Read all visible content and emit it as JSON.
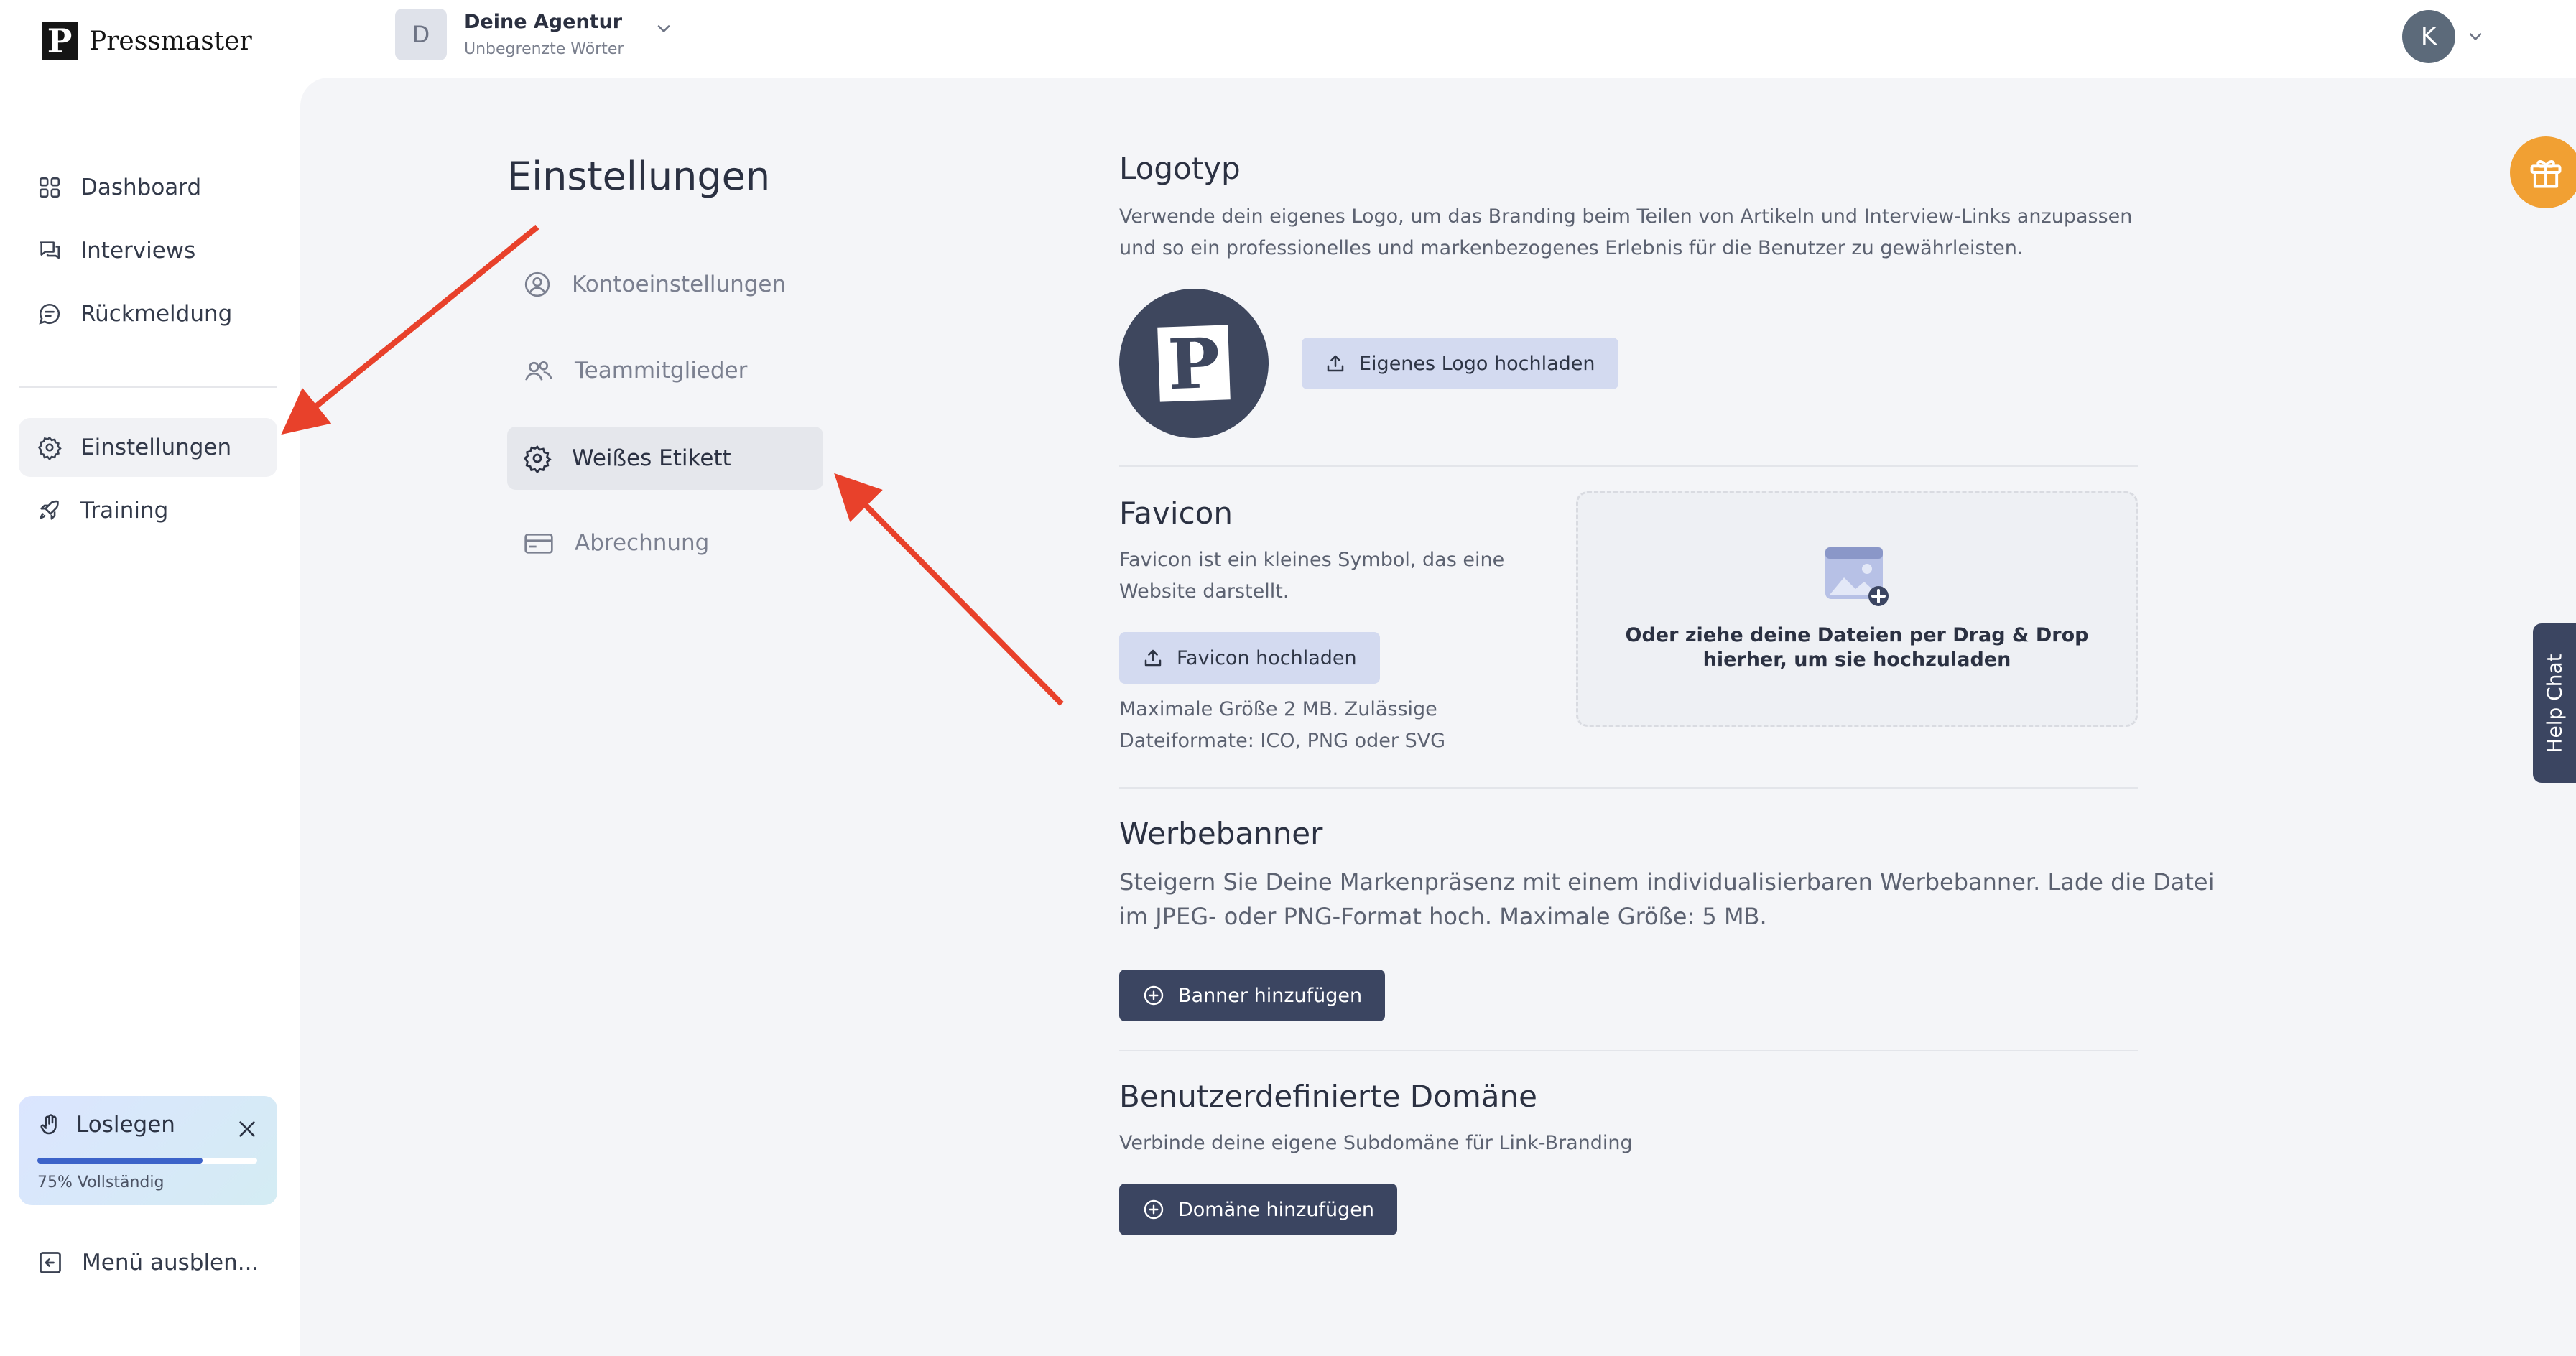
{
  "app": {
    "name": "Pressmaster",
    "logo_letter": "P"
  },
  "agency": {
    "avatar_letter": "D",
    "name": "Deine Agentur",
    "subtitle": "Unbegrenzte Wörter"
  },
  "user": {
    "avatar_letter": "K"
  },
  "sidebar": {
    "items": [
      {
        "label": "Dashboard",
        "icon": "dashboard-icon"
      },
      {
        "label": "Interviews",
        "icon": "chat-icon"
      },
      {
        "label": "Rückmeldung",
        "icon": "feedback-icon"
      },
      {
        "label": "Einstellungen",
        "icon": "gear-icon",
        "active": true
      },
      {
        "label": "Training",
        "icon": "rocket-icon"
      }
    ],
    "onboarding": {
      "label": "Loslegen",
      "progress_percent": 75,
      "progress_text": "75% Vollständig"
    },
    "collapse_label": "Menü ausblen..."
  },
  "settings": {
    "title": "Einstellungen",
    "menu": [
      {
        "label": "Kontoeinstellungen",
        "icon": "user-circle-icon"
      },
      {
        "label": "Teammitglieder",
        "icon": "users-icon"
      },
      {
        "label": "Weißes Etikett",
        "icon": "gear-icon",
        "active": true
      },
      {
        "label": "Abrechnung",
        "icon": "card-icon"
      }
    ]
  },
  "logotype": {
    "title": "Logotyp",
    "description_line1": "Verwende dein eigenes Logo, um das Branding beim Teilen von Artikeln und Interview-Links anzupassen",
    "description_line2": "und so ein professionelles und markenbezogenes Erlebnis für die Benutzer zu gewährleisten.",
    "upload_label": "Eigenes Logo hochladen"
  },
  "favicon": {
    "title": "Favicon",
    "description_line1": "Favicon ist ein kleines Symbol, das eine",
    "description_line2": "Website darstellt.",
    "upload_label": "Favicon hochladen",
    "limits_line1": "Maximale Größe 2 MB. Zulässige",
    "limits_line2": "Dateiformate: ICO, PNG oder SVG",
    "dropzone_text": "Oder ziehe deine Dateien per Drag & Drop hierher, um sie hochzuladen"
  },
  "banner": {
    "title": "Werbebanner",
    "description_line1": "Steigern Sie Deine Markenpräsenz mit einem individualisierbaren Werbebanner. Lade die Datei",
    "description_line2": "im JPEG- oder PNG-Format hoch. Maximale Größe: 5 MB.",
    "add_label": "Banner hinzufügen"
  },
  "domain": {
    "title": "Benutzerdefinierte Domäne",
    "description": "Verbinde deine eigene Subdomäne für Link-Branding",
    "add_label": "Domäne hinzufügen"
  },
  "help_chat_label": "Help Chat",
  "colors": {
    "accent_dark": "#3b4561",
    "accent_light": "#d3daf0",
    "gift": "#f1a033",
    "arrow": "#e8412b"
  }
}
